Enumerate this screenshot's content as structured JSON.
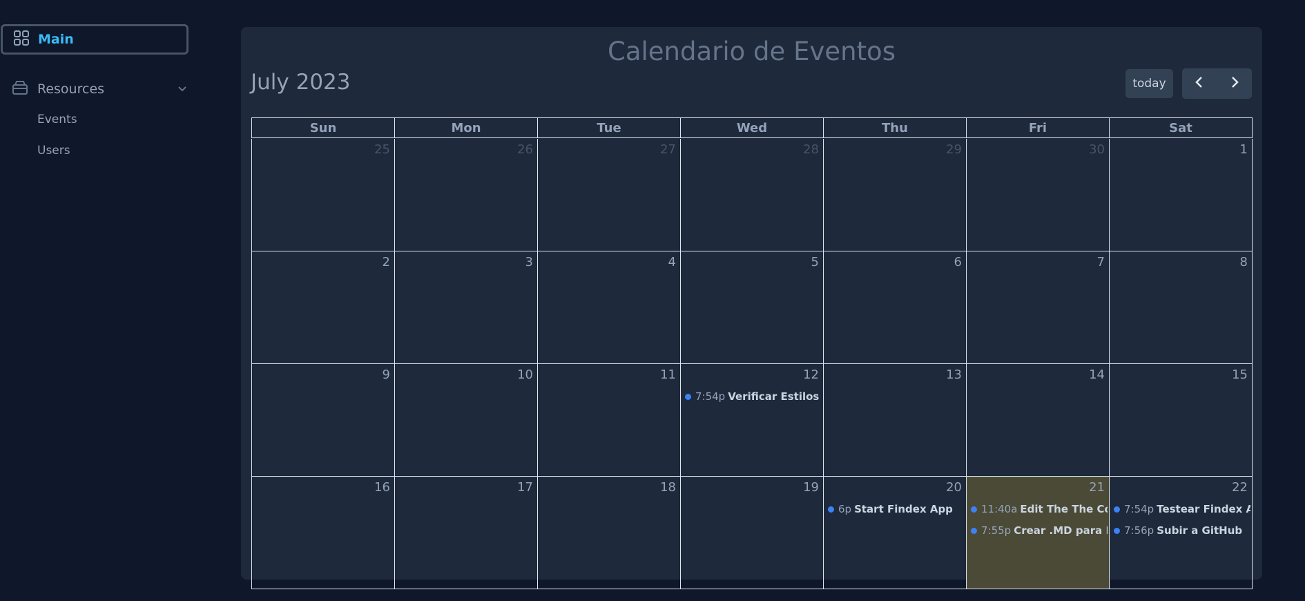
{
  "sidebar": {
    "main_label": "Main",
    "resources_label": "Resources",
    "items": [
      {
        "label": "Events"
      },
      {
        "label": "Users"
      }
    ]
  },
  "calendar": {
    "title": "Calendario de Eventos",
    "month": "July 2023",
    "today_label": "today",
    "weekdays": [
      "Sun",
      "Mon",
      "Tue",
      "Wed",
      "Thu",
      "Fri",
      "Sat"
    ],
    "weeks": [
      [
        {
          "n": "25",
          "other": true
        },
        {
          "n": "26",
          "other": true
        },
        {
          "n": "27",
          "other": true
        },
        {
          "n": "28",
          "other": true
        },
        {
          "n": "29",
          "other": true
        },
        {
          "n": "30",
          "other": true
        },
        {
          "n": "1"
        }
      ],
      [
        {
          "n": "2"
        },
        {
          "n": "3"
        },
        {
          "n": "4"
        },
        {
          "n": "5"
        },
        {
          "n": "6"
        },
        {
          "n": "7"
        },
        {
          "n": "8"
        }
      ],
      [
        {
          "n": "9"
        },
        {
          "n": "10"
        },
        {
          "n": "11"
        },
        {
          "n": "12",
          "events": [
            {
              "time": "7:54p",
              "title": "Verificar Estilos"
            }
          ]
        },
        {
          "n": "13"
        },
        {
          "n": "14"
        },
        {
          "n": "15"
        }
      ],
      [
        {
          "n": "16"
        },
        {
          "n": "17"
        },
        {
          "n": "18"
        },
        {
          "n": "19"
        },
        {
          "n": "20",
          "events": [
            {
              "time": "6p",
              "title": "Start Findex App"
            }
          ]
        },
        {
          "n": "21",
          "today": true,
          "events": [
            {
              "time": "11:40a",
              "title": "Edit The The Code"
            },
            {
              "time": "7:55p",
              "title": "Crear .MD para Findex"
            }
          ]
        },
        {
          "n": "22",
          "events": [
            {
              "time": "7:54p",
              "title": "Testear Findex App"
            },
            {
              "time": "7:56p",
              "title": "Subir a GitHub"
            }
          ]
        }
      ]
    ],
    "event_color": "#3b82f6",
    "today_highlight": "#4b4a36"
  }
}
